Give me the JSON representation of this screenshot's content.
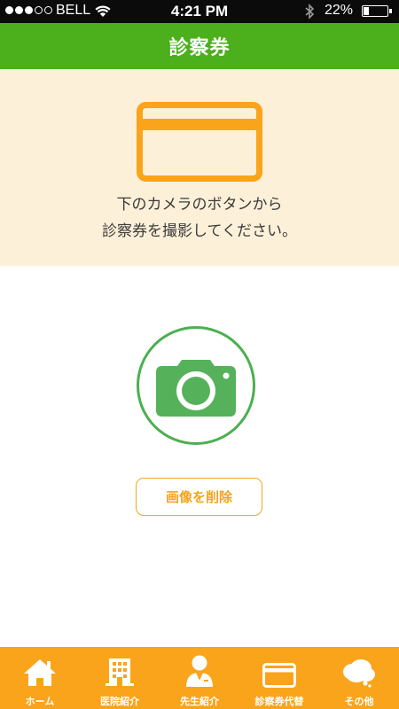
{
  "status_bar": {
    "carrier": "BELL",
    "time": "4:21 PM",
    "battery_percent": "22%",
    "battery_level": 0.22,
    "signal_dots_filled": 3,
    "signal_dots_total": 5
  },
  "header": {
    "title": "診察券"
  },
  "instruction": {
    "icon": "card-icon",
    "line1": "下のカメラのボタンから",
    "line2": "診察券を撮影してください。"
  },
  "camera": {
    "icon": "camera-icon"
  },
  "delete_button": {
    "label": "画像を削除"
  },
  "tabs": [
    {
      "label": "ホーム",
      "icon": "home-icon"
    },
    {
      "label": "医院紹介",
      "icon": "building-icon"
    },
    {
      "label": "先生紹介",
      "icon": "doctor-icon"
    },
    {
      "label": "診察券代替",
      "icon": "card-icon"
    },
    {
      "label": "その他",
      "icon": "speech-bubble-icon"
    }
  ],
  "colors": {
    "header": "#4caf1c",
    "accent_orange": "#f9a41b",
    "panel_background": "#fdf0d8",
    "camera_green": "#4caf50"
  }
}
